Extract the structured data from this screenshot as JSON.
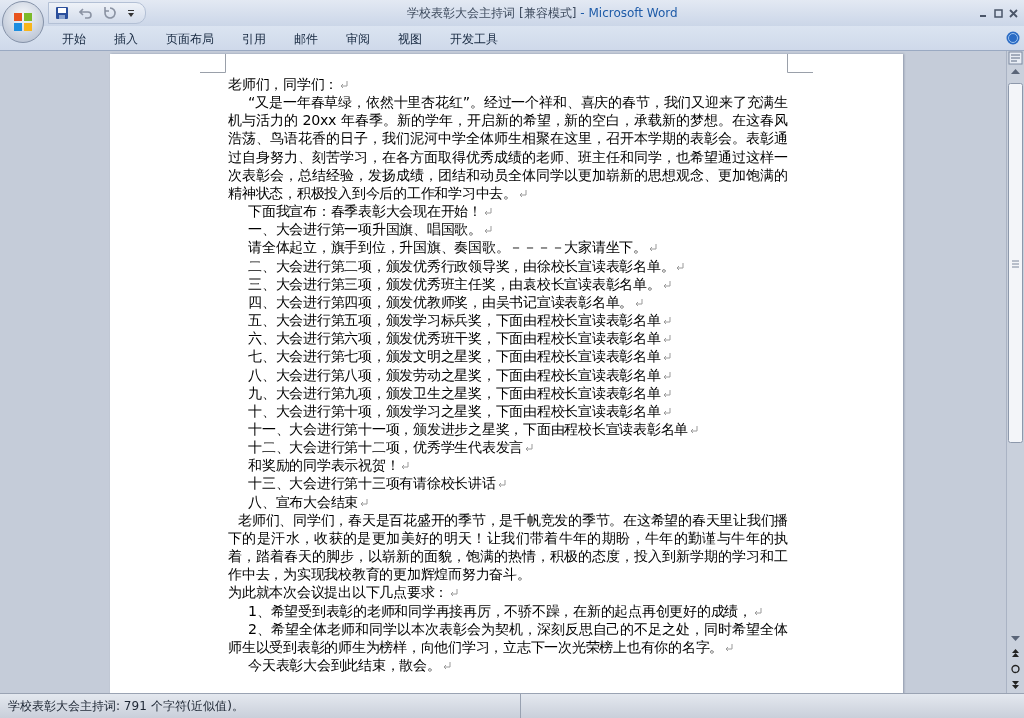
{
  "window": {
    "document_title": "学校表彰大会主持词 [兼容模式]",
    "app_title": "- Microsoft Word"
  },
  "quick_access": [
    {
      "kind": "save"
    },
    {
      "kind": "undo"
    },
    {
      "kind": "redo"
    },
    {
      "kind": "customize"
    }
  ],
  "ribbon_tabs": [
    {
      "label": "开始",
      "selected": false
    },
    {
      "label": "插入",
      "selected": false
    },
    {
      "label": "页面布局",
      "selected": false
    },
    {
      "label": "引用",
      "selected": false
    },
    {
      "label": "邮件",
      "selected": false
    },
    {
      "label": "审阅",
      "selected": false
    },
    {
      "label": "视图",
      "selected": false
    },
    {
      "label": "开发工具",
      "selected": false
    }
  ],
  "document": {
    "paragraphs": [
      {
        "text": "老师们，同学们：",
        "kind": "flush",
        "mark": true
      },
      {
        "text": "“又是一年春草绿，依然十里杏花红”。经过一个祥和、喜庆的春节，我们又迎来了充满生机与活力的 20xx 年春季。新的学年，开启新的希望，新的空白，承载新的梦想。在这春风浩荡、鸟语花香的日子，我们泥河中学全体师生相聚在这里，召开本学期的表彰会。表彰通过自身努力、刻苦学习，在各方面取得优秀成绩的老师、班主任和同学，也希望通过这样一次表彰会，总结经验，发扬成绩，团结和动员全体同学以更加崭新的思想观念、更加饱满的精神状态，积极投入到今后的工作和学习中去。",
        "kind": "indented",
        "mark": true
      },
      {
        "text": "下面我宣布：春季表彰大会现在开始！",
        "kind": "indented",
        "mark": true
      },
      {
        "text": "一、大会进行第一项升国旗、唱国歌。",
        "kind": "indented",
        "mark": true
      },
      {
        "text": "请全体起立，旗手到位，升国旗、奏国歌。－－－－大家请坐下。",
        "kind": "indented",
        "mark": true
      },
      {
        "text": "二、大会进行第二项，颁发优秀行政领导奖，由徐校长宣读表彰名单。",
        "kind": "indented",
        "mark": true
      },
      {
        "text": "三、大会进行第三项，颁发优秀班主任奖，由袁校长宣读表彰名单。",
        "kind": "indented",
        "mark": true
      },
      {
        "text": "四、大会进行第四项，颁发优教师奖，由吴书记宣读表彰名单。",
        "kind": "indented",
        "mark": true
      },
      {
        "text": "五、大会进行第五项，颁发学习标兵奖，下面由程校长宣读表彰名单",
        "kind": "indented",
        "mark": true
      },
      {
        "text": "六、大会进行第六项，颁发优秀班干奖，下面由程校长宣读表彰名单",
        "kind": "indented",
        "mark": true
      },
      {
        "text": "七、大会进行第七项，颁发文明之星奖，下面由程校长宣读表彰名单",
        "kind": "indented",
        "mark": true
      },
      {
        "text": "八、大会进行第八项，颁发劳动之星奖，下面由程校长宣读表彰名单",
        "kind": "indented",
        "mark": true
      },
      {
        "text": "九、大会进行第九项，颁发卫生之星奖，下面由程校长宣读表彰名单",
        "kind": "indented",
        "mark": true
      },
      {
        "text": "十、大会进行第十项，颁发学习之星奖，下面由程校长宣读表彰名单",
        "kind": "indented",
        "mark": true
      },
      {
        "text": "十一、大会进行第十一项，颁发进步之星奖，下面由程校长宣读表彰名单",
        "kind": "indented",
        "mark": true
      },
      {
        "text": "十二、大会进行第十二项，优秀学生代表发言",
        "kind": "indented",
        "mark": true
      },
      {
        "text": "和奖励的同学表示祝贺！",
        "kind": "indented",
        "mark": true
      },
      {
        "text": "十三、大会进行第十三项有请徐校长讲话",
        "kind": "indented",
        "mark": true
      },
      {
        "text": "八、宣布大会结束",
        "kind": "indented",
        "mark": true
      },
      {
        "text": "老师们、同学们，春天是百花盛开的季节，是千帆竞发的季节。在这希望的春天里让我们播下的是汗水，收获的是更加美好的明天！让我们带着牛年的期盼，牛年的勤谨与牛年的执着，踏着春天的脚步，以崭新的面貌，饱满的热情，积极的态度，投入到新学期的学习和工作中去，为实现我校教育的更加辉煌而努力奋斗。",
        "kind": "half-indented",
        "mark": false
      },
      {
        "text": "为此就本次会议提出以下几点要求：",
        "kind": "flush",
        "mark": true
      },
      {
        "text": "1、希望受到表彰的老师和同学再接再厉，不骄不躁，在新的起点再创更好的成绩，",
        "kind": "indented",
        "mark": true
      },
      {
        "text": "2、希望全体老师和同学以本次表彰会为契机，深刻反思自己的不足之处，同时希望全体师生以受到表彰的师生为榜样，向他们学习，立志下一次光荣榜上也有你的名字。",
        "kind": "indented",
        "mark": true
      },
      {
        "text": "今天表彰大会到此结束，散会。",
        "kind": "indented",
        "mark": true
      }
    ]
  },
  "status_bar": {
    "word_count": "学校表彰大会主持词: 791 个字符(近似值)。"
  }
}
